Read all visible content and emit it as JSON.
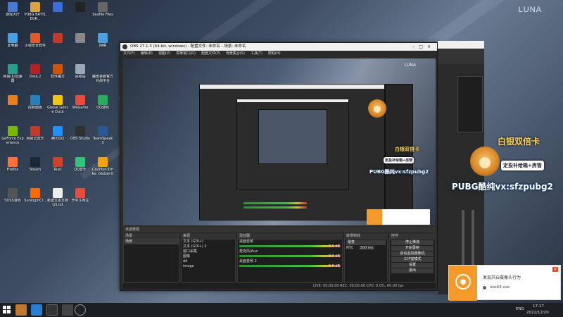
{
  "wallpaper": {
    "brand": "LUNA",
    "preview_brand": "LUNA"
  },
  "desktop_icons": [
    {
      "label": "游戏大厅",
      "color": "#4a7bd1"
    },
    {
      "label": "PUBG BATTLEGR...",
      "color": "#d9a441"
    },
    {
      "label": "",
      "color": "#3b6fd8"
    },
    {
      "label": "",
      "color": "#222222"
    },
    {
      "label": "Seafile Files",
      "color": "#666666"
    },
    {
      "label": "此电脑",
      "color": "#4aa0e0"
    },
    {
      "label": "火绒安全软件",
      "color": "#e05a2b"
    },
    {
      "label": "",
      "color": "#c0392b"
    },
    {
      "label": "",
      "color": "#888888"
    },
    {
      "label": "网络",
      "color": "#4aa0e0"
    },
    {
      "label": "网易UU加速器",
      "color": "#2a9d8f"
    },
    {
      "label": "Dota 2",
      "color": "#b22222"
    },
    {
      "label": "软件魔方",
      "color": "#d35400"
    },
    {
      "label": "回收站",
      "color": "#9aa7b5"
    },
    {
      "label": "魔兽争霸官方对战平台",
      "color": "#2c3e50"
    },
    {
      "label": "",
      "color": "#e67e22"
    },
    {
      "label": "控制面板",
      "color": "#2980b9"
    },
    {
      "label": "Goose Goose Duck",
      "color": "#f1c40f"
    },
    {
      "label": "WeGame",
      "color": "#e74c3c"
    },
    {
      "label": "QQ游戏",
      "color": "#27ae60"
    },
    {
      "label": "GeForce Experience",
      "color": "#76b900"
    },
    {
      "label": "网易云音乐",
      "color": "#c0392b"
    },
    {
      "label": "腾讯QQ",
      "color": "#1e90ff"
    },
    {
      "label": "OBS Studio",
      "color": "#303030"
    },
    {
      "label": "TeamSpeak 3",
      "color": "#2b5797"
    },
    {
      "label": "Firefox",
      "color": "#ff7139"
    },
    {
      "label": "Steam",
      "color": "#1b2838"
    },
    {
      "label": "Rust",
      "color": "#ce422b"
    },
    {
      "label": "QQ音乐",
      "color": "#31c27c"
    },
    {
      "label": "Counter-Strike: Global Off...",
      "color": "#f0a30a"
    },
    {
      "label": "SOSS游戏",
      "color": "#555555"
    },
    {
      "label": "SunloginCl...",
      "color": "#ff6a00"
    },
    {
      "label": "新建文本文档 (2).txt",
      "color": "#eeeeee"
    },
    {
      "label": "开平斗地主",
      "color": "#e74c3c"
    }
  ],
  "obs": {
    "title": "OBS 27.1.3 (64-bit, windows) - 配置文件: 未命名 - 场景: 未命名",
    "menu": [
      "文件(F)",
      "编辑(E)",
      "视图(V)",
      "停靠窗口(D)",
      "配置文件(P)",
      "场景集合(S)",
      "工具(T)",
      "帮助(H)"
    ],
    "docks": {
      "scenes_header": "场景",
      "sources_header": "来源",
      "mixer_header": "混音器",
      "transitions_header": "转场特效",
      "controls_header": "控件",
      "no_source": "未选择源",
      "scene_item": "场景",
      "sources": [
        "文本 (GDI+)",
        "文本 (GDI+) 2",
        "窗口采集",
        "图像",
        "dd",
        "image"
      ],
      "mixer_tracks": [
        "桌面音频",
        "麦克风/Aux",
        "桌面音频 2"
      ],
      "mixer_db": [
        "0.0 dB",
        "0.0 dB",
        "0.0 dB"
      ],
      "transition": "渐变",
      "duration_label": "时长",
      "duration": "300 ms",
      "controls": [
        "停止推流",
        "开始录制",
        "启动虚拟摄像机",
        "工作室模式",
        "设置",
        "退出"
      ],
      "status": "LIVE: 00:00:00   REC: 00:00:00   CPU: 0.0%, 60.00 fps"
    }
  },
  "overlays": {
    "double_card": "白银双倍卡",
    "tagline": "定投补给箱+房管",
    "pubg_wechat": "PUBG酷纯vx:sfzpubg2"
  },
  "notification": {
    "message": "发现开启摄像头行为",
    "app": "obs64.exe",
    "close_label": "×"
  },
  "taskbar": {
    "lang": "ENG",
    "time": "17:17",
    "date": "2022/12/20"
  }
}
